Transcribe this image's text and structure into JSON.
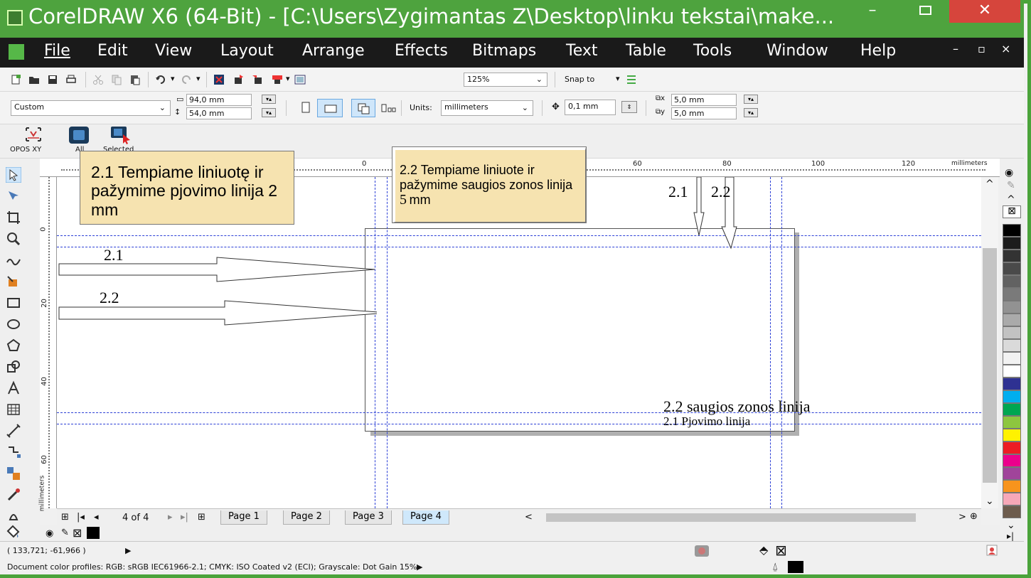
{
  "window": {
    "title": "CorelDRAW X6 (64-Bit) - [C:\\Users\\Zygimantas Z\\Desktop\\linku tekstai\\make...",
    "min_label": "–",
    "close_label": "✕"
  },
  "menu": {
    "items": [
      "File",
      "Edit",
      "View",
      "Layout",
      "Arrange",
      "Effects",
      "Bitmaps",
      "Text",
      "Table",
      "Tools",
      "Window",
      "Help"
    ],
    "doc_controls": [
      "–",
      "▫",
      "×"
    ]
  },
  "toolbar": {
    "zoom": "125%",
    "snap_to": "Snap to",
    "preset": "Custom",
    "width": "94,0 mm",
    "height": "54,0 mm",
    "units_label": "Units:",
    "units_value": "millimeters",
    "nudge": "0,1 mm",
    "dup_x": "5,0 mm",
    "dup_y": "5,0 mm"
  },
  "toolbar3": {
    "opos": "OPOS XY",
    "all": "All",
    "selected": "Selected"
  },
  "ruler": {
    "top_ticks": [
      "0",
      "60",
      "80",
      "100",
      "120"
    ],
    "unit": "millimeters",
    "left_ticks": [
      "0",
      "20",
      "40",
      "60"
    ],
    "left_unit": "millimeters"
  },
  "annotations": {
    "note1": "2.1 Tempiame liniuotę ir pažymime pjovimo linija 2 mm",
    "note2_a": "2.2 Tempiame liniuote ir pažymime saugios zonos linija ",
    "note2_num": "5",
    "note2_b": "mm",
    "arrow1": "2.1",
    "arrow2": "2.2",
    "top_arrow1": "2.1",
    "top_arrow2": "2.2",
    "safe_label": "2.2 saugios zonos linija",
    "cut_label": "2.1 Pjovimo linija"
  },
  "pages": {
    "counter": "4 of 4",
    "tabs": [
      "Page 1",
      "Page 2",
      "Page 3",
      "Page 4"
    ],
    "active": "Page 4"
  },
  "status": {
    "coords": "( 133,721; -61,966 )",
    "profiles": "Document color profiles: RGB: sRGB IEC61966-2.1; CMYK: ISO Coated v2 (ECI); Grayscale: Dot Gain 15%"
  },
  "palette": [
    "#000000",
    "#1c1c1c",
    "#333333",
    "#4a4a4a",
    "#626262",
    "#7a7a7a",
    "#929292",
    "#aaaaaa",
    "#c2c2c2",
    "#dadada",
    "#f2f2f2",
    "#ffffff",
    "#2e3192",
    "#00aeef",
    "#00a651",
    "#8dc63f",
    "#fff200",
    "#ed1c24",
    "#ec008c",
    "#a0449a",
    "#f7941d",
    "#f7a8b8",
    "#6d5c4d"
  ]
}
